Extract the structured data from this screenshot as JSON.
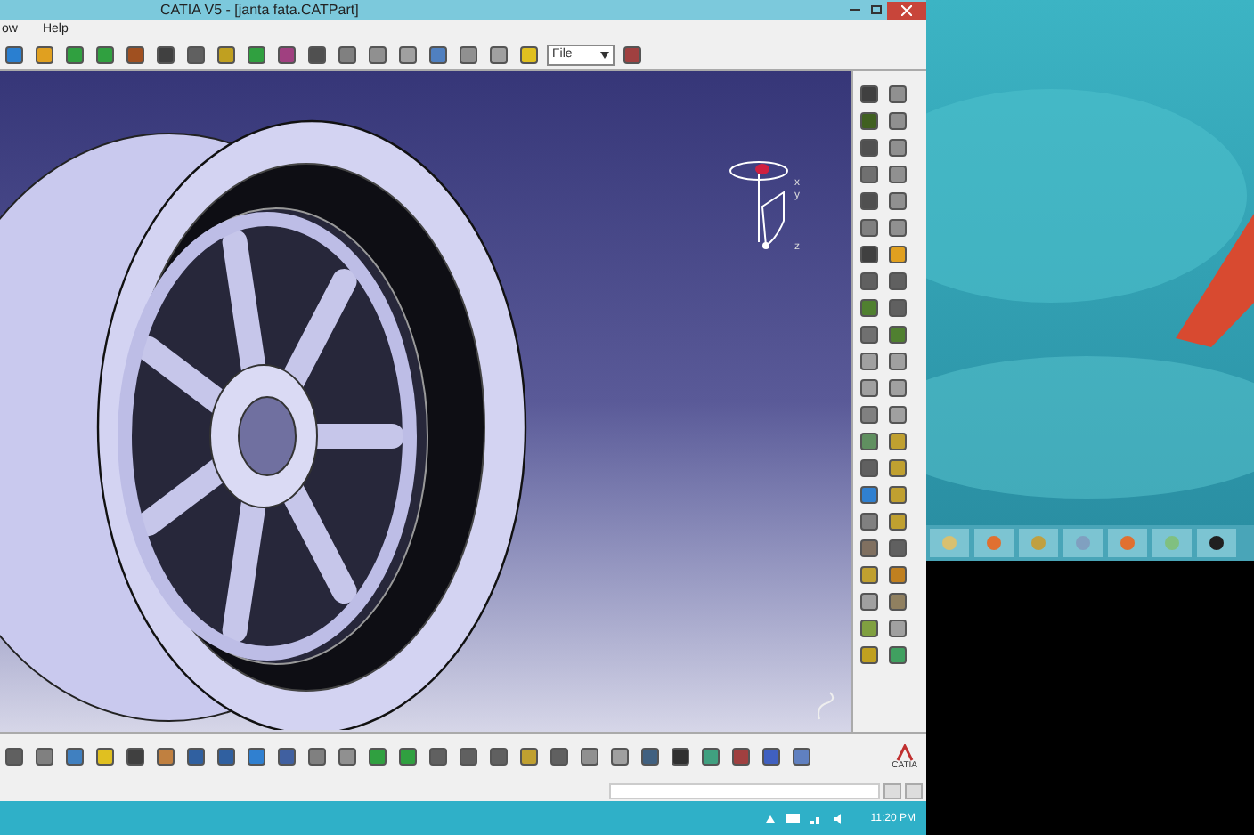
{
  "window": {
    "title": "CATIA V5 - [janta fata.CATPart]"
  },
  "menu": [
    "ow",
    "Help"
  ],
  "toolbar": {
    "dropdown_value": "File"
  },
  "compass": {
    "axes": [
      "x",
      "y",
      "z"
    ]
  },
  "brand": "CATIA",
  "taskbar": {
    "clock": "11:20 PM"
  }
}
